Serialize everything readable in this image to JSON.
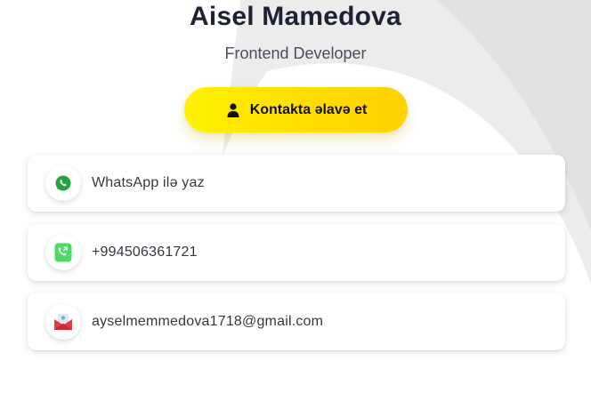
{
  "profile": {
    "name": "Aisel Mamedova",
    "title": "Frontend Developer"
  },
  "add_contact": {
    "label": "Kontakta əlavə et",
    "icon": "person-icon",
    "color_start": "#fff200",
    "color_end": "#ffd200"
  },
  "contacts": [
    {
      "label": "WhatsApp ilə yaz",
      "icon": "whatsapp-icon",
      "color": "#25a244"
    },
    {
      "label": "+994506361721",
      "icon": "phone-icon",
      "color": "#4cd964"
    },
    {
      "label": "ayselmemmedova1718@gmail.com",
      "icon": "mail-icon",
      "color": "#e53946"
    }
  ]
}
